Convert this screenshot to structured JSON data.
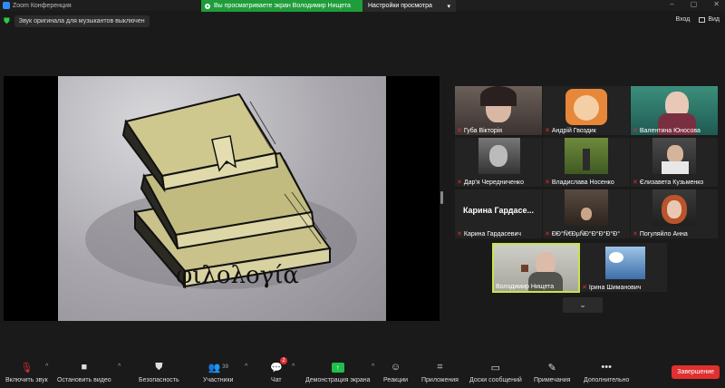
{
  "window": {
    "title": "Zoom Конференция",
    "controls": [
      "–",
      "▢",
      "✕"
    ]
  },
  "share_banner": {
    "text": "Вы просматриваете экран Володимир Нищета"
  },
  "view_options": {
    "label": "Настройки просмотра"
  },
  "music_notice": {
    "text": "Звук оригинала для музыкантов выключен"
  },
  "top_right": {
    "exit_label": "Вход",
    "view_label": "Вид"
  },
  "slide": {
    "text": "φιλολογία"
  },
  "participants": [
    {
      "name": "Губа Вікторія",
      "muted": true
    },
    {
      "name": "Андрій Гвоздик",
      "muted": true
    },
    {
      "name": "Валентина Юносова",
      "muted": true
    },
    {
      "name": "Дар'я Чередниченко",
      "muted": true
    },
    {
      "name": "Владислава Носенко",
      "muted": true
    },
    {
      "name": "Єлизавета Кузьменко",
      "muted": true
    },
    {
      "name": "Карина Гардасевич",
      "muted": true,
      "big_label": "Карина  Гардасе..."
    },
    {
      "name": "ÐÐ°Ñ€ÐµÑÐ°Ð°Ð°Ð°Ð°",
      "muted": true
    },
    {
      "name": "Погуляйло Анна",
      "muted": true
    },
    {
      "name": "Володимир Нищета",
      "muted": false
    },
    {
      "name": "Ірина Шиманович",
      "muted": true
    }
  ],
  "toolbar": {
    "mute_label": "Включить звук",
    "video_label": "Остановить видео",
    "security_label": "Безопасность",
    "participants_label": "Участники",
    "participants_count": "39",
    "chat_label": "Чат",
    "chat_badge": "2",
    "share_label": "Демонстрация экрана",
    "reactions_label": "Реакции",
    "apps_label": "Приложения",
    "whiteboard_label": "Доски сообщений",
    "notes_label": "Примечания",
    "more_label": "Дополнительно",
    "end_label": "Завершение"
  },
  "colors": {
    "share_green": "#1f9d3a",
    "end_red": "#e0302f",
    "active_speaker": "#c9e54a"
  }
}
